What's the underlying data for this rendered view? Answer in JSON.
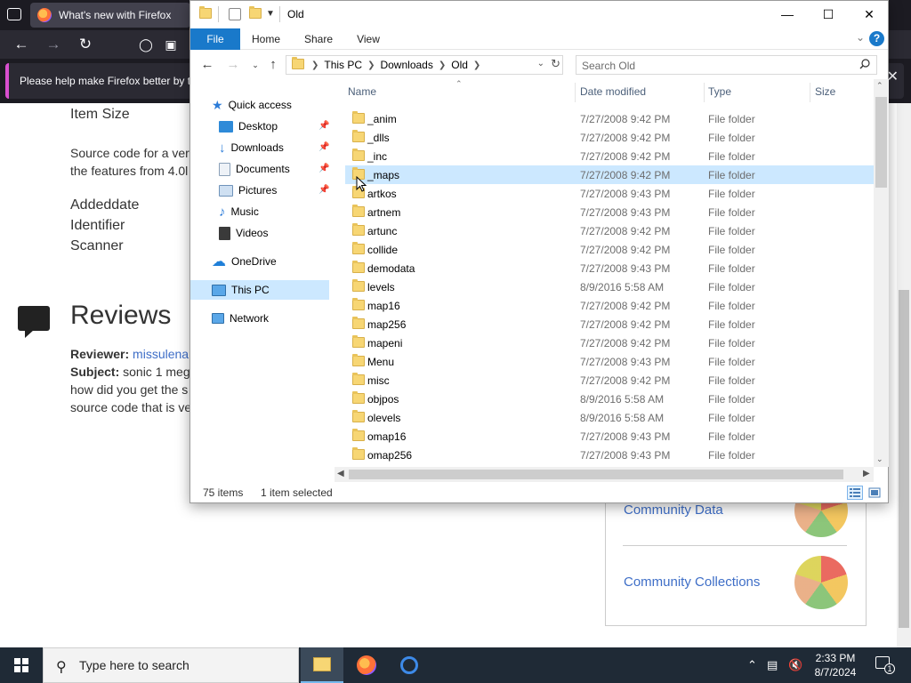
{
  "browser": {
    "tab_title": "What's new with Firefox",
    "notification": "Please help make Firefox better by ta"
  },
  "page": {
    "item_size": "Item Size",
    "source_line1": "Source code for a ver",
    "source_line2": "the features from 4.0l",
    "addeddate": "Addeddate",
    "identifier": "Identifier",
    "scanner": "Scanner",
    "reviews_title": "Reviews",
    "reviewer_label": "Reviewer:",
    "reviewer_name": "missulena",
    "subject_label": "Subject:",
    "subject_text": "sonic 1 meg",
    "review_line2": "how did you get the s",
    "review_line3": "source code that is ve",
    "community_data": "Community Data",
    "community_collections": "Community Collections"
  },
  "explorer": {
    "title": "Old",
    "ribbon_tabs": [
      "File",
      "Home",
      "Share",
      "View"
    ],
    "help": "?",
    "breadcrumb": [
      "This PC",
      "Downloads",
      "Old"
    ],
    "search_placeholder": "Search Old",
    "nav": {
      "quick_access": "Quick access",
      "desktop": "Desktop",
      "downloads": "Downloads",
      "documents": "Documents",
      "pictures": "Pictures",
      "music": "Music",
      "videos": "Videos",
      "onedrive": "OneDrive",
      "this_pc": "This PC",
      "network": "Network"
    },
    "columns": [
      "Name",
      "Date modified",
      "Type",
      "Size"
    ],
    "files": [
      {
        "name": "_anim",
        "date": "7/27/2008 9:42 PM",
        "type": "File folder"
      },
      {
        "name": "_dlls",
        "date": "7/27/2008 9:42 PM",
        "type": "File folder"
      },
      {
        "name": "_inc",
        "date": "7/27/2008 9:42 PM",
        "type": "File folder"
      },
      {
        "name": "_maps",
        "date": "7/27/2008 9:42 PM",
        "type": "File folder"
      },
      {
        "name": "artkos",
        "date": "7/27/2008 9:43 PM",
        "type": "File folder"
      },
      {
        "name": "artnem",
        "date": "7/27/2008 9:43 PM",
        "type": "File folder"
      },
      {
        "name": "artunc",
        "date": "7/27/2008 9:42 PM",
        "type": "File folder"
      },
      {
        "name": "collide",
        "date": "7/27/2008 9:42 PM",
        "type": "File folder"
      },
      {
        "name": "demodata",
        "date": "7/27/2008 9:43 PM",
        "type": "File folder"
      },
      {
        "name": "levels",
        "date": "8/9/2016 5:58 AM",
        "type": "File folder"
      },
      {
        "name": "map16",
        "date": "7/27/2008 9:42 PM",
        "type": "File folder"
      },
      {
        "name": "map256",
        "date": "7/27/2008 9:42 PM",
        "type": "File folder"
      },
      {
        "name": "mapeni",
        "date": "7/27/2008 9:42 PM",
        "type": "File folder"
      },
      {
        "name": "Menu",
        "date": "7/27/2008 9:43 PM",
        "type": "File folder"
      },
      {
        "name": "misc",
        "date": "7/27/2008 9:42 PM",
        "type": "File folder"
      },
      {
        "name": "objpos",
        "date": "8/9/2016 5:58 AM",
        "type": "File folder"
      },
      {
        "name": "olevels",
        "date": "8/9/2016 5:58 AM",
        "type": "File folder"
      },
      {
        "name": "omap16",
        "date": "7/27/2008 9:43 PM",
        "type": "File folder"
      },
      {
        "name": "omap256",
        "date": "7/27/2008 9:43 PM",
        "type": "File folder"
      }
    ],
    "status_items": "75 items",
    "status_selected": "1 item selected"
  },
  "taskbar": {
    "search_placeholder": "Type here to search",
    "time": "2:33 PM",
    "date": "8/7/2024",
    "notification_count": "1"
  }
}
